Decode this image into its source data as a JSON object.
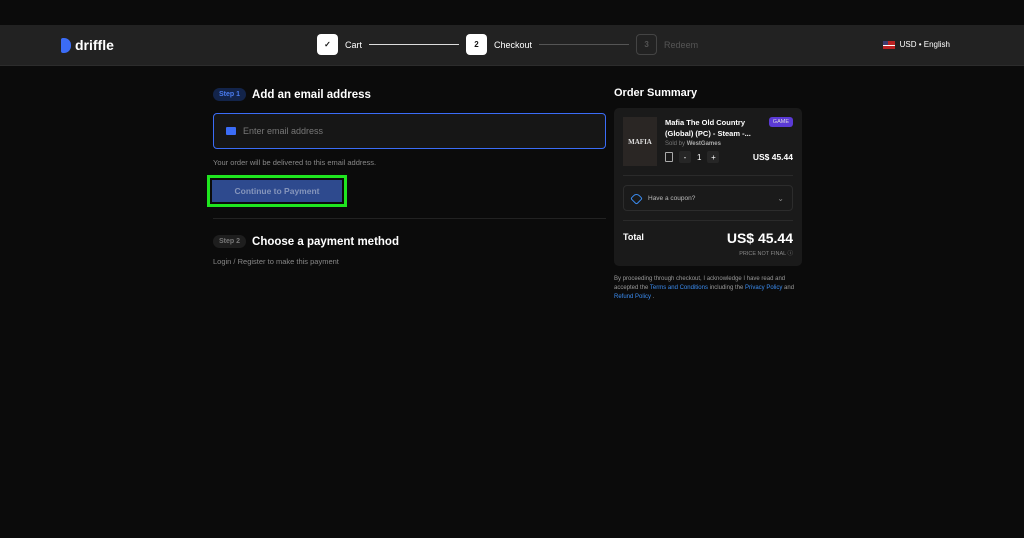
{
  "header": {
    "logo": "driffle",
    "steps": [
      {
        "label": "Cart",
        "marker": "✓"
      },
      {
        "label": "Checkout",
        "marker": "2"
      },
      {
        "label": "Redeem",
        "marker": "3"
      }
    ],
    "locale": "USD • English"
  },
  "step1": {
    "badge": "Step 1",
    "title": "Add an email address",
    "placeholder": "Enter email address",
    "note": "Your order will be delivered to this email address.",
    "button": "Continue to Payment"
  },
  "step2": {
    "badge": "Step 2",
    "title": "Choose a payment method",
    "note": "Login / Register to make this payment"
  },
  "summary": {
    "title": "Order Summary",
    "product": {
      "image_text": "MAFIA",
      "title": "Mafia The Old Country (Global) (PC) - Steam -...",
      "badge": "GAME",
      "sold_by_label": "Sold by",
      "seller": "WestGames",
      "qty": "1",
      "minus": "-",
      "plus": "+",
      "price": "US$ 45.44"
    },
    "coupon": "Have a coupon?",
    "total_label": "Total",
    "total": "US$ 45.44",
    "price_note": "PRICE NOT FINAL ⓘ",
    "legal": {
      "t1": "By proceeding through checkout, I acknowledge I have read and accepted the",
      "terms": "Terms and Conditions",
      "t2": "including the",
      "privacy": "Privacy Policy",
      "t3": "and",
      "refund": "Refund Policy",
      "t4": "."
    }
  }
}
